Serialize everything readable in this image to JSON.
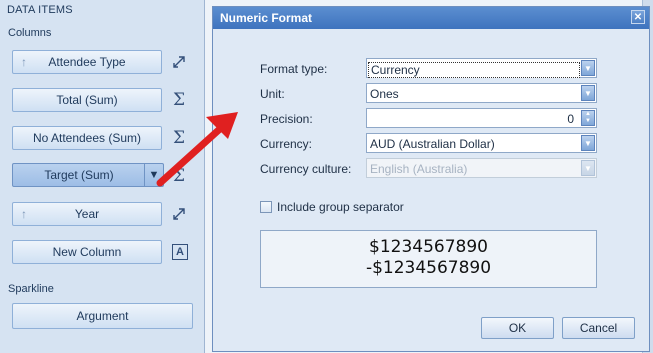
{
  "panel": {
    "title": "DATA ITEMS",
    "columns_label": "Columns",
    "sparkline_label": "Sparkline",
    "columns": [
      {
        "label": "Attendee Type",
        "arrow": "arrow-up-icon",
        "side_icon": "dimension-settings-icon"
      },
      {
        "label": "Total (Sum)",
        "side_icon": "sigma-icon"
      },
      {
        "label": "No Attendees (Sum)",
        "side_icon": "sigma-icon"
      },
      {
        "label": "Target (Sum)",
        "side_icon": "sigma-icon",
        "selected": true
      },
      {
        "label": "Year",
        "arrow": "arrow-up-icon",
        "side_icon": "dimension-settings-icon"
      },
      {
        "label": "New Column",
        "side_icon": "text-a-icon"
      }
    ],
    "sparkline_button": "Argument"
  },
  "dialog": {
    "title": "Numeric Format",
    "fields": {
      "format_type": {
        "label": "Format type:",
        "value": "Currency"
      },
      "unit": {
        "label": "Unit:",
        "value": "Ones"
      },
      "precision": {
        "label": "Precision:",
        "value": "0"
      },
      "currency": {
        "label": "Currency:",
        "value": "AUD (Australian Dollar)"
      },
      "currency_culture": {
        "label": "Currency culture:",
        "value": "English (Australia)"
      }
    },
    "group_separator_label": "Include group separator",
    "group_separator_checked": false,
    "preview": {
      "positive": "$1234567890",
      "negative": "-$1234567890"
    },
    "ok_label": "OK",
    "cancel_label": "Cancel"
  },
  "colors": {
    "annotation_arrow": "#e02020",
    "titlebar": "#4a7fc6",
    "panel_bg": "#d6e3f2"
  }
}
